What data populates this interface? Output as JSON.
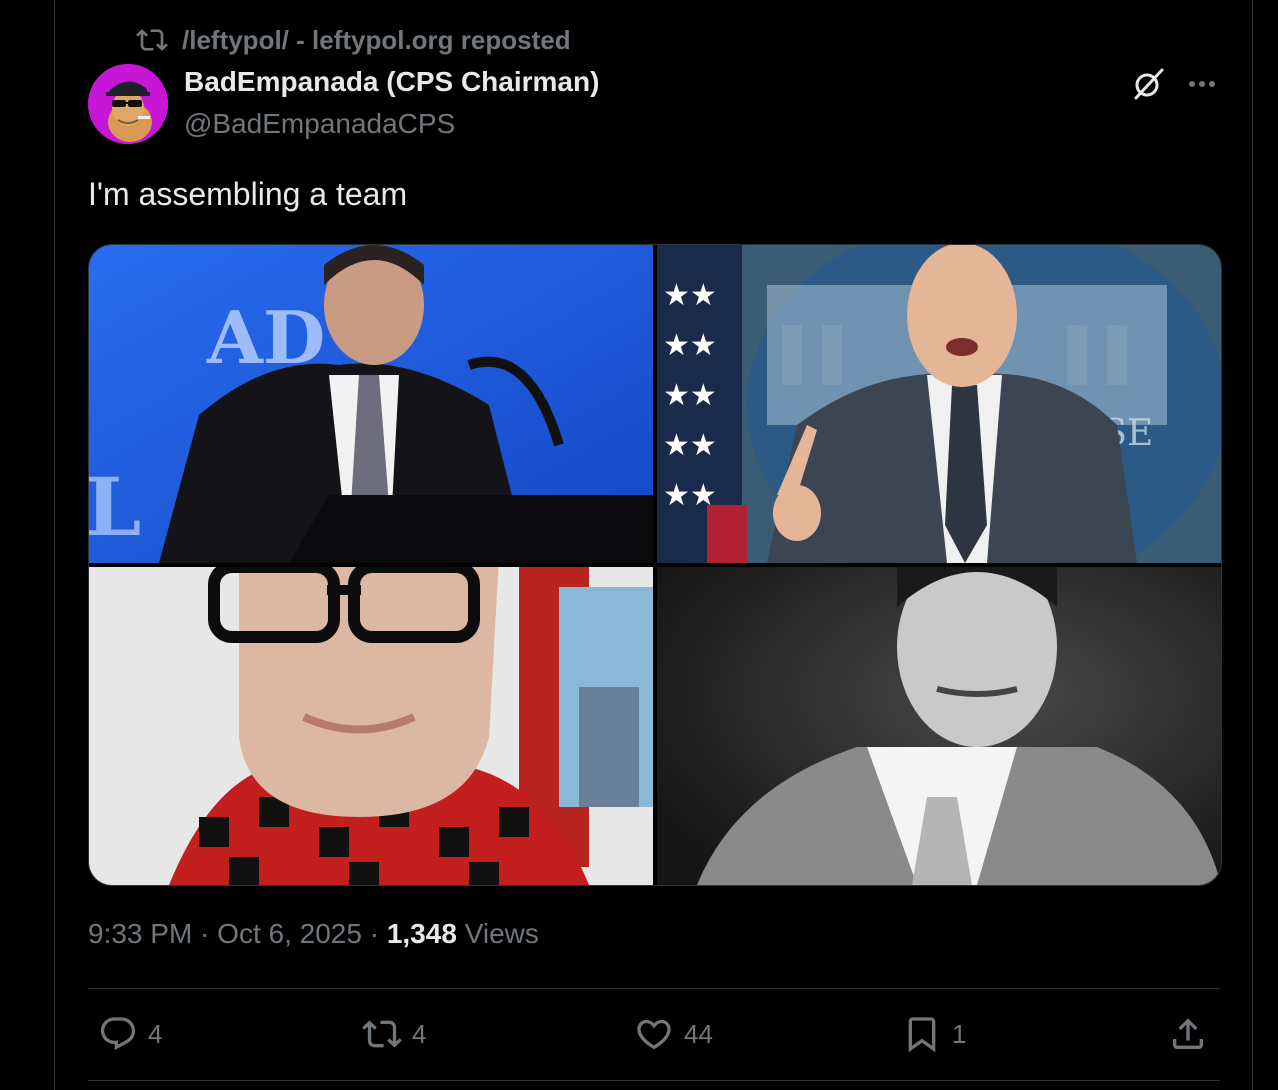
{
  "repost": {
    "label": "/leftypol/ - leftypol.org reposted"
  },
  "author": {
    "display_name": "BadEmpanada (CPS Chairman)",
    "handle": "@BadEmpanadaCPS"
  },
  "tweet": {
    "text": "I'm assembling a team"
  },
  "media": {
    "count": 4,
    "images": [
      {
        "description": "man speaking at ADL podium, blue background",
        "icon": "photo"
      },
      {
        "description": "man speaking at White House briefing, pointing",
        "icon": "photo"
      },
      {
        "description": "close-up of man with black glasses and red plaid shirt",
        "icon": "photo"
      },
      {
        "description": "black and white portrait of man in suit",
        "icon": "photo"
      }
    ]
  },
  "meta": {
    "time": "9:33 PM",
    "separator": " · ",
    "date": "Oct 6, 2025",
    "views_count": "1,348",
    "views_label": "Views"
  },
  "actions": {
    "replies": "4",
    "reposts": "4",
    "likes": "44",
    "bookmarks": "1"
  },
  "colors": {
    "background": "#000000",
    "text": "#e7e9ea",
    "muted": "#71767b",
    "border": "#2f3336",
    "avatar": "#c816d6"
  },
  "icons": [
    "repost-icon",
    "grok-icon",
    "more-icon",
    "reply-icon",
    "like-icon",
    "bookmark-icon",
    "share-icon"
  ]
}
